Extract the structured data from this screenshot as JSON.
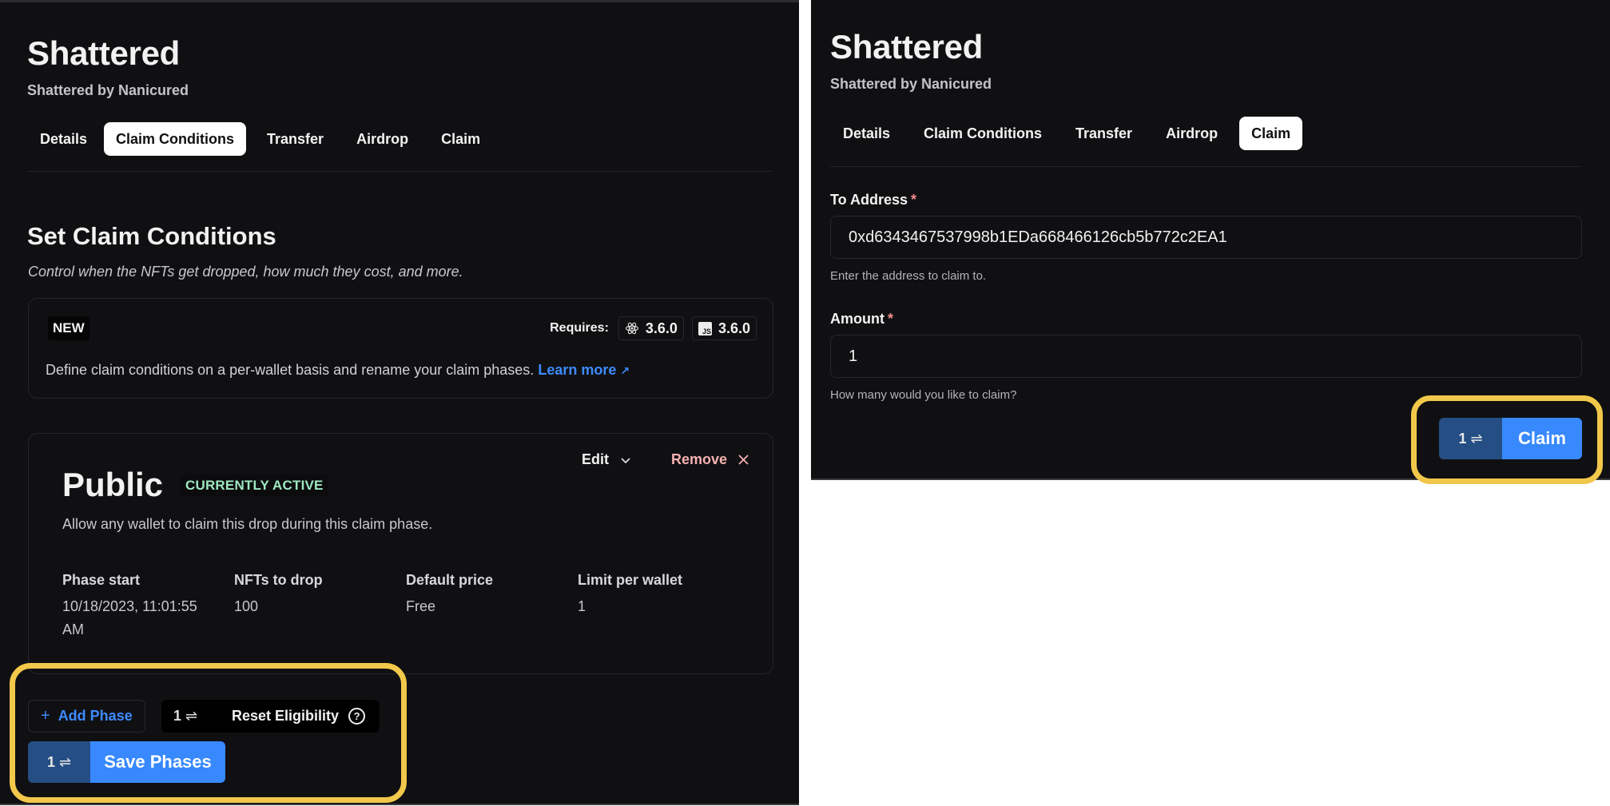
{
  "left": {
    "title": "Shattered",
    "subtitle": "Shattered by Nanicured",
    "tabs": [
      {
        "label": "Details",
        "active": false
      },
      {
        "label": "Claim Conditions",
        "active": true
      },
      {
        "label": "Transfer",
        "active": false
      },
      {
        "label": "Airdrop",
        "active": false
      },
      {
        "label": "Claim",
        "active": false
      }
    ],
    "section_title": "Set Claim Conditions",
    "section_subtitle": "Control when the NFTs get dropped, how much they cost, and more.",
    "notice": {
      "badge": "NEW",
      "requires_label": "Requires:",
      "react_icon": "react-icon",
      "react_version": "3.6.0",
      "js_icon": "js-icon",
      "js_icon_text": "JS",
      "js_version": "3.6.0",
      "text": "Define claim conditions on a per-wallet basis and rename your claim phases.",
      "link_label": "Learn more",
      "link_icon": "↗"
    },
    "phase": {
      "name": "Public",
      "status": "CURRENTLY ACTIVE",
      "edit_label": "Edit",
      "edit_icon": "chevron-down-icon",
      "remove_label": "Remove",
      "remove_icon": "close-icon",
      "description": "Allow any wallet to claim this drop during this claim phase.",
      "fields": [
        {
          "label": "Phase start",
          "value": "10/18/2023, 11:01:55 AM"
        },
        {
          "label": "NFTs to drop",
          "value": "100"
        },
        {
          "label": "Default price",
          "value": "Free"
        },
        {
          "label": "Limit per wallet",
          "value": "1"
        }
      ]
    },
    "actions": {
      "add_phase_icon": "+",
      "add_phase_label": "Add Phase",
      "reset_count": "1",
      "reset_label": "Reset Eligibility",
      "reset_help_icon": "?",
      "save_count": "1",
      "save_label": "Save Phases",
      "swap_icon": "⇌"
    },
    "highlight_color": "#f2c84b"
  },
  "right": {
    "title": "Shattered",
    "subtitle": "Shattered by Nanicured",
    "tabs": [
      {
        "label": "Details",
        "active": false
      },
      {
        "label": "Claim Conditions",
        "active": false
      },
      {
        "label": "Transfer",
        "active": false
      },
      {
        "label": "Airdrop",
        "active": false
      },
      {
        "label": "Claim",
        "active": true
      }
    ],
    "to_address": {
      "label": "To Address",
      "required_mark": "*",
      "value": "0xd6343467537998b1EDa668466126cb5b772c2EA1",
      "help": "Enter the address to claim to."
    },
    "amount": {
      "label": "Amount",
      "required_mark": "*",
      "value": "1",
      "help": "How many would you like to claim?"
    },
    "claim_count": "1",
    "claim_label": "Claim",
    "swap_icon": "⇌"
  },
  "colors": {
    "background": "#101012",
    "accent": "#3889fd",
    "accent_dark": "#254e85",
    "link": "#3d8bff",
    "active_badge": "#9ee8c1",
    "remove": "#f6b1b1",
    "highlight": "#f2c84b"
  }
}
